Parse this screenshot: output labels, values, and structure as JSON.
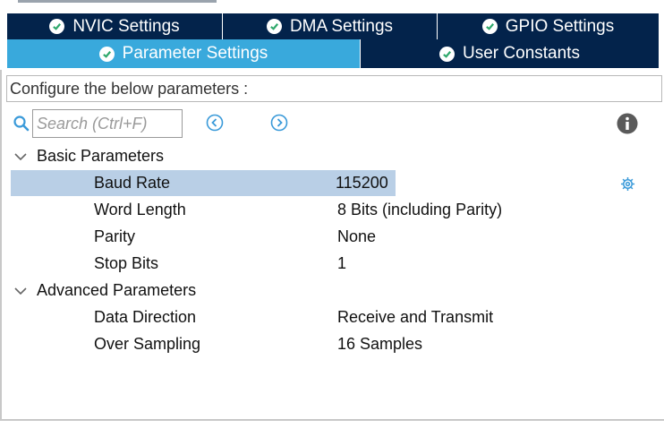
{
  "tabs_row1": [
    {
      "label": "NVIC Settings"
    },
    {
      "label": "DMA Settings"
    },
    {
      "label": "GPIO Settings"
    }
  ],
  "tabs_row2": [
    {
      "label": "Parameter Settings",
      "active": true
    },
    {
      "label": "User Constants"
    }
  ],
  "configure_label": "Configure the below parameters :",
  "search": {
    "placeholder": "Search (Ctrl+F)"
  },
  "groups": [
    {
      "label": "Basic Parameters",
      "params": [
        {
          "name": "Baud Rate",
          "value": "115200"
        },
        {
          "name": "Word Length",
          "value": "8 Bits (including Parity)"
        },
        {
          "name": "Parity",
          "value": "None"
        },
        {
          "name": "Stop Bits",
          "value": "1"
        }
      ]
    },
    {
      "label": "Advanced Parameters",
      "params": [
        {
          "name": "Data Direction",
          "value": "Receive and Transmit"
        },
        {
          "name": "Over Sampling",
          "value": "16 Samples"
        }
      ]
    }
  ],
  "colors": {
    "tab_dark": "#03234b",
    "tab_active": "#39a9dc",
    "tab_check": "#2ea86b",
    "selection": "#b9cfe6",
    "icon_blue": "#3a9ad9"
  },
  "icons": [
    "check-circle-icon",
    "search-icon",
    "chevron-left-icon",
    "chevron-right-icon",
    "info-icon",
    "chevron-down-icon",
    "gear-icon"
  ]
}
